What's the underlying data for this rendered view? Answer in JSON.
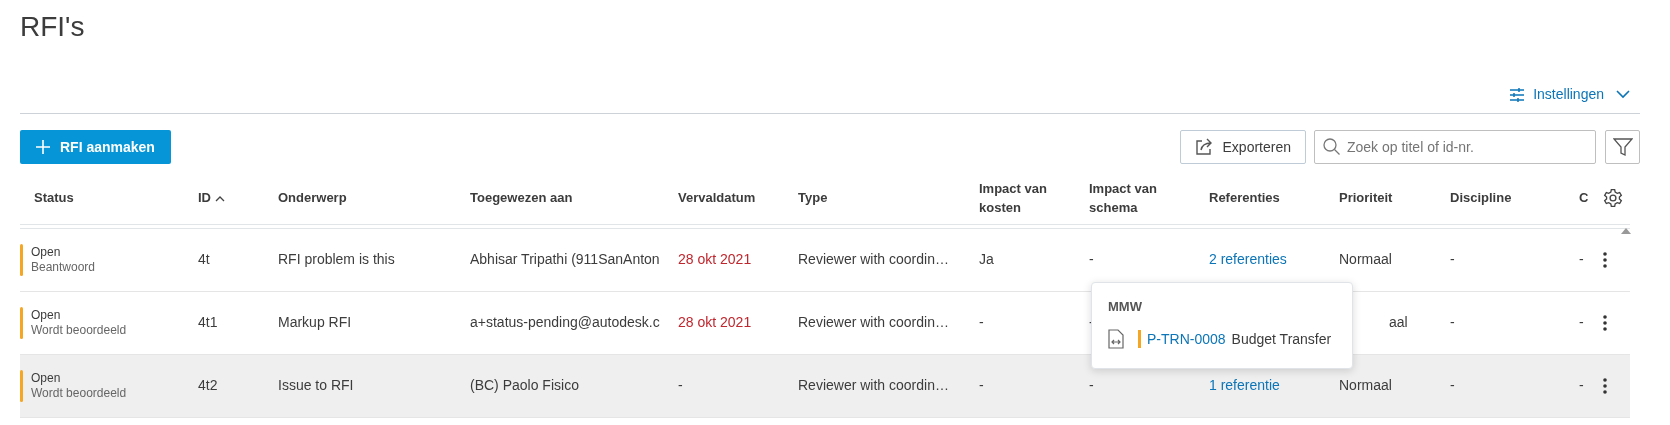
{
  "page_title": "RFI's",
  "settings_link": {
    "label": "Instellingen"
  },
  "create_button": {
    "label": "RFI aanmaken"
  },
  "export_button": {
    "label": "Exporteren"
  },
  "search": {
    "placeholder": "Zoek op titel of id-nr."
  },
  "table": {
    "columns": [
      {
        "label": "Status"
      },
      {
        "label": "ID",
        "sorted": true
      },
      {
        "label": "Onderwerp"
      },
      {
        "label": "Toegewezen aan"
      },
      {
        "label": "Vervaldatum"
      },
      {
        "label": "Type"
      },
      {
        "label": "Impact van kosten"
      },
      {
        "label": "Impact van schema"
      },
      {
        "label": "Referenties"
      },
      {
        "label": "Prioriteit"
      },
      {
        "label": "Discipline"
      },
      {
        "label": "C"
      }
    ],
    "rows": [
      {
        "status": "Open",
        "substatus": "Beantwoord",
        "color": "#f5a623",
        "id": "4t",
        "subject": "RFI problem is this",
        "assignee": "Abhisar Tripathi (911SanAnton",
        "due": "28 okt 2021",
        "overdue": true,
        "type": "Reviewer with coordin…",
        "cost": "Ja",
        "schedule": "-",
        "references": "2 referenties",
        "priority": "Normaal",
        "discipline": "-",
        "column_12": "-",
        "highlighted": false
      },
      {
        "status": "Open",
        "substatus": "Wordt beoordeeld",
        "color": "#f5a623",
        "id": "4t1",
        "subject": "Markup RFI",
        "assignee": "a+status-pending@autodesk.c",
        "due": "28 okt 2021",
        "overdue": true,
        "type": "Reviewer with coordin…",
        "cost": "-",
        "schedule": "-",
        "priority": "aal",
        "priority_covered": true,
        "discipline": "-",
        "column_12": "-",
        "highlighted": false
      },
      {
        "status": "Open",
        "substatus": "Wordt beoordeeld",
        "color": "#f5a623",
        "id": "4t2",
        "subject": "Issue to RFI",
        "assignee": "(BC) Paolo Fisico",
        "due": "-",
        "overdue": false,
        "type": "Reviewer with coordin…",
        "cost": "-",
        "schedule": "-",
        "references": "1 referentie",
        "priority": "Normaal",
        "discipline": "-",
        "column_12": "-",
        "highlighted": true
      }
    ]
  },
  "popover": {
    "heading": "MMW",
    "items": [
      {
        "code": "P-TRN-0008",
        "title": "Budget Transfer",
        "color": "#f5a623"
      }
    ]
  }
}
